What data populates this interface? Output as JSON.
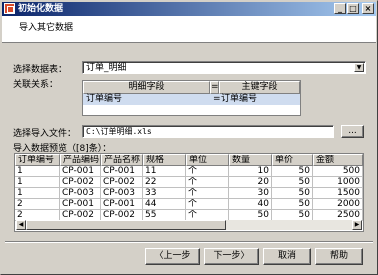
{
  "window": {
    "title": "初始化数据",
    "minimize": "_",
    "maximize": "□",
    "close": "×"
  },
  "header": {
    "subtitle": "导入其它数据"
  },
  "form": {
    "table_label": "选择数据表：",
    "table_value": "订单_明细",
    "relation_label": "关联关系：",
    "file_label": "选择导入文件：",
    "file_value": "C:\\订单明细.xls",
    "browse_label": "...",
    "preview_label": "导入数据预览（[8]条）："
  },
  "mapping": {
    "headers": [
      "明细字段",
      "=",
      "主键字段"
    ],
    "row": {
      "detail": "订单编号",
      "eq": "=",
      "primary": "订单编号"
    }
  },
  "preview": {
    "columns": [
      "订单编号",
      "产品编码",
      "产品名称",
      "规格",
      "单位",
      "数量",
      "单价",
      "金额"
    ],
    "rows": [
      [
        "1",
        "CP-001",
        "CP-001",
        "11",
        "个",
        "10",
        "50",
        "500"
      ],
      [
        "1",
        "CP-002",
        "CP-002",
        "22",
        "个",
        "20",
        "50",
        "1000"
      ],
      [
        "1",
        "CP-003",
        "CP-003",
        "33",
        "个",
        "30",
        "50",
        "1500"
      ],
      [
        "2",
        "CP-001",
        "CP-001",
        "44",
        "个",
        "40",
        "50",
        "2000"
      ],
      [
        "2",
        "CP-002",
        "CP-002",
        "55",
        "个",
        "50",
        "50",
        "2500"
      ]
    ]
  },
  "buttons": {
    "back": "〈上一步",
    "next": "下一步〉",
    "cancel": "取消",
    "help": "帮助"
  }
}
